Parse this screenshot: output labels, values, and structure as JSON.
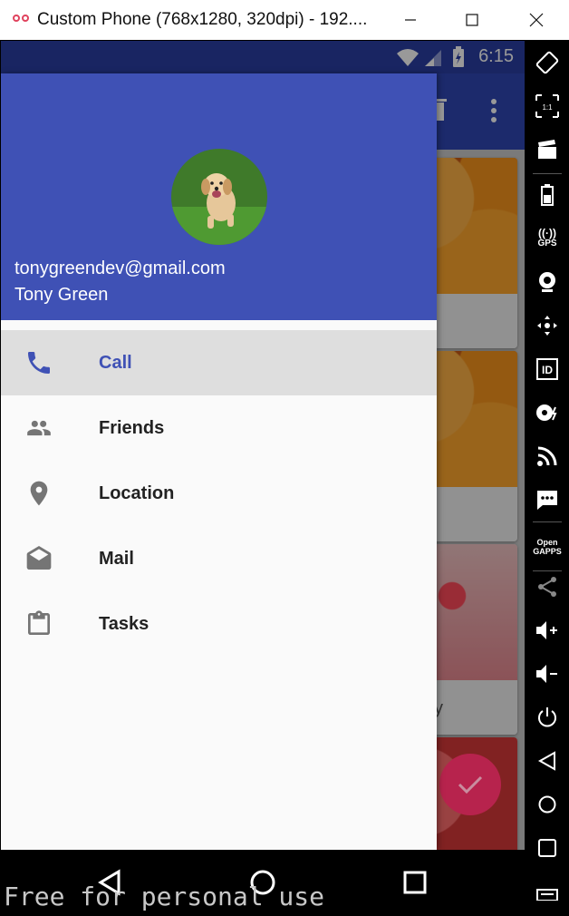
{
  "window": {
    "title": "Custom Phone (768x1280, 320dpi) - 192...."
  },
  "status_bar": {
    "time": "6:15"
  },
  "drawer": {
    "email": "tonygreendev@gmail.com",
    "name": "Tony Green",
    "items": [
      {
        "label": "Call",
        "icon": "phone-icon",
        "selected": true
      },
      {
        "label": "Friends",
        "icon": "people-icon",
        "selected": false
      },
      {
        "label": "Location",
        "icon": "location-pin-icon",
        "selected": false
      },
      {
        "label": "Mail",
        "icon": "open-mail-icon",
        "selected": false
      },
      {
        "label": "Tasks",
        "icon": "clipboard-icon",
        "selected": false
      }
    ]
  },
  "background_cards": [
    {
      "image": "oranges",
      "caption": ""
    },
    {
      "image": "oranges",
      "caption": ""
    },
    {
      "image": "strawberry",
      "caption": "y"
    },
    {
      "image": "watermelon",
      "caption": ""
    }
  ],
  "emulator_toolbar": {
    "gps_label": "GPS",
    "id_label": "ID",
    "opengapps_label": "Open GAPPS"
  },
  "watermark": "Free for personal use",
  "colors": {
    "primary": "#3f51b5",
    "status_bar": "#2a3ea3",
    "fab": "#e91e63",
    "selected_row": "#dedede"
  }
}
